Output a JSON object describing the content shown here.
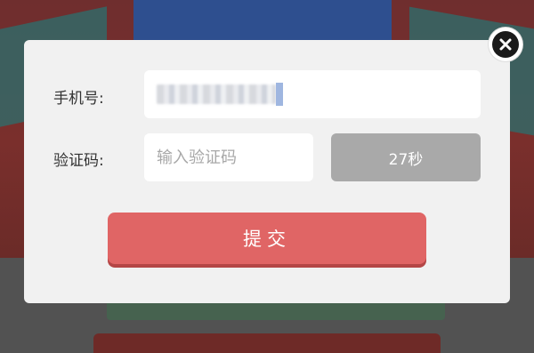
{
  "modal": {
    "phone_label": "手机号:",
    "code_label": "验证码:",
    "code_placeholder": "输入验证码",
    "countdown_label": "27秒",
    "submit_label": "提交",
    "close_icon": "close-icon"
  },
  "colors": {
    "submit": "#e06565",
    "countdown": "#a9a9a9",
    "modal_bg": "#f1f1f1"
  }
}
